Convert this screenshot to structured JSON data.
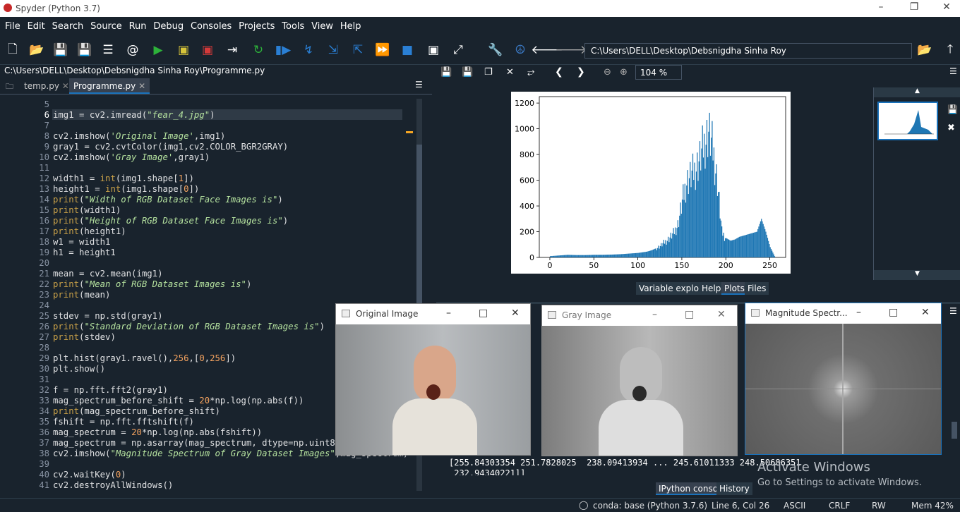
{
  "window": {
    "title": "Spyder (Python 3.7)"
  },
  "menu": [
    "File",
    "Edit",
    "Search",
    "Source",
    "Run",
    "Debug",
    "Consoles",
    "Projects",
    "Tools",
    "View",
    "Help"
  ],
  "toolbar": {
    "path": "C:\\Users\\DELL\\Desktop\\Debsnigdha Sinha Roy"
  },
  "editor": {
    "filepath": "C:\\Users\\DELL\\Desktop\\Debsnigdha Sinha Roy\\Programme.py",
    "tabs": [
      "temp.py",
      "Programme.py"
    ],
    "active_tab": "Programme.py",
    "current_line": 6,
    "lines": [
      {
        "n": "5",
        "t": ""
      },
      {
        "n": "6",
        "t": "img1 = cv2.imread(\"fear_4.jpg\")"
      },
      {
        "n": "7",
        "t": ""
      },
      {
        "n": "8",
        "t": "cv2.imshow('Original Image',img1)"
      },
      {
        "n": "9",
        "t": "gray1 = cv2.cvtColor(img1,cv2.COLOR_BGR2GRAY)"
      },
      {
        "n": "10",
        "t": "cv2.imshow('Gray Image',gray1)"
      },
      {
        "n": "11",
        "t": ""
      },
      {
        "n": "12",
        "t": "width1 = int(img1.shape[1])"
      },
      {
        "n": "13",
        "t": "height1 = int(img1.shape[0])"
      },
      {
        "n": "14",
        "t": "print(\"Width of RGB Dataset Face Images is\")"
      },
      {
        "n": "15",
        "t": "print(width1)"
      },
      {
        "n": "16",
        "t": "print(\"Height of RGB Dataset Face Images is\")"
      },
      {
        "n": "17",
        "t": "print(height1)"
      },
      {
        "n": "18",
        "t": "w1 = width1"
      },
      {
        "n": "19",
        "t": "h1 = height1"
      },
      {
        "n": "20",
        "t": ""
      },
      {
        "n": "21",
        "t": "mean = cv2.mean(img1)"
      },
      {
        "n": "22",
        "t": "print(\"Mean of RGB Dataset Images is\")"
      },
      {
        "n": "23",
        "t": "print(mean)"
      },
      {
        "n": "24",
        "t": ""
      },
      {
        "n": "25",
        "t": "stdev = np.std(gray1)"
      },
      {
        "n": "26",
        "t": "print(\"Standard Deviation of RGB Dataset Images is\")"
      },
      {
        "n": "27",
        "t": "print(stdev)"
      },
      {
        "n": "28",
        "t": ""
      },
      {
        "n": "29",
        "t": "plt.hist(gray1.ravel(),256,[0,256])"
      },
      {
        "n": "30",
        "t": "plt.show()"
      },
      {
        "n": "31",
        "t": ""
      },
      {
        "n": "32",
        "t": "f = np.fft.fft2(gray1)"
      },
      {
        "n": "33",
        "t": "mag_spectrum_before_shift = 20*np.log(np.abs(f))"
      },
      {
        "n": "34",
        "t": "print(mag_spectrum_before_shift)"
      },
      {
        "n": "35",
        "t": "fshift = np.fft.fftshift(f)"
      },
      {
        "n": "36",
        "t": "mag_spectrum = 20*np.log(np.abs(fshift))"
      },
      {
        "n": "37",
        "t": "mag_spectrum = np.asarray(mag_spectrum, dtype=np.uint8)"
      },
      {
        "n": "38",
        "t": "cv2.imshow(\"Magnitude Spectrum of Gray Dataset Images\",mag_spectrum)"
      },
      {
        "n": "39",
        "t": ""
      },
      {
        "n": "40",
        "t": "cv2.waitKey(0)"
      },
      {
        "n": "41",
        "t": "cv2.destroyAllWindows()"
      }
    ]
  },
  "plots": {
    "zoom": "104 %",
    "tabs": [
      "Variable explorer",
      "Help",
      "Plots",
      "Files"
    ],
    "active_tab": "Plots"
  },
  "chart_data": {
    "type": "bar",
    "title": "",
    "xlabel": "",
    "ylabel": "",
    "xlim": [
      -12,
      268
    ],
    "ylim": [
      0,
      1250
    ],
    "xticks": [
      0,
      50,
      100,
      150,
      200,
      250
    ],
    "yticks": [
      0,
      200,
      400,
      600,
      800,
      1000,
      1200
    ],
    "color": "#1f77b4",
    "x": [
      0,
      10,
      20,
      30,
      40,
      50,
      60,
      70,
      80,
      90,
      100,
      110,
      115,
      120,
      125,
      130,
      135,
      140,
      145,
      150,
      155,
      160,
      165,
      170,
      175,
      180,
      185,
      190,
      195,
      200,
      205,
      210,
      215,
      220,
      225,
      230,
      235,
      240,
      245,
      250,
      255
    ],
    "values": [
      10,
      15,
      20,
      18,
      18,
      20,
      20,
      22,
      25,
      30,
      35,
      45,
      55,
      70,
      90,
      120,
      150,
      190,
      260,
      440,
      600,
      650,
      700,
      780,
      900,
      1000,
      850,
      600,
      200,
      150,
      130,
      140,
      160,
      170,
      180,
      190,
      200,
      300,
      200,
      80,
      10
    ]
  },
  "console": {
    "tabs": [
      "IPython console",
      "History"
    ],
    "active_tab": "IPython console",
    "output_line1": "[255.84303354 251.7828025  238.09413934 ... 245.61011333 248.50686351",
    "output_line2": " 232.94340221]]"
  },
  "cv_windows": [
    {
      "title": "Original Image"
    },
    {
      "title": "Gray Image"
    },
    {
      "title": "Magnitude Spectr..."
    }
  ],
  "watermark": {
    "line1": "Activate Windows",
    "line2": "Go to Settings to activate Windows."
  },
  "statusbar": {
    "env": "conda: base (Python 3.7.6)",
    "position": "Line 6, Col 26",
    "encoding": "ASCII",
    "eol": "CRLF",
    "rw": "RW",
    "mem": "Mem 42%"
  }
}
